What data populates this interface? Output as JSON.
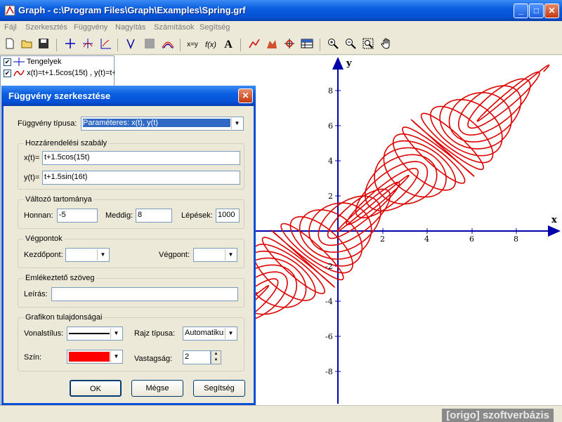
{
  "window": {
    "title": "Graph - c:\\Program Files\\Graph\\Examples\\Spring.grf",
    "min": "_",
    "max": "□",
    "close": "✕"
  },
  "menu": [
    "Fájl",
    "Szerkesztés",
    "Függvény",
    "Nagyítás",
    "Számítások",
    "Segítség"
  ],
  "toolbar": {
    "xy_label": "x=y",
    "fx_label": "f(x)",
    "text_label": "A"
  },
  "tree": {
    "items": [
      {
        "label": "Tengelyek",
        "checked": "✔"
      },
      {
        "label": "x(t)=t+1.5cos(15t) , y(t)=t+",
        "checked": "✔"
      }
    ]
  },
  "dialog": {
    "title": "Függvény szerkesztése",
    "close": "✕",
    "type_label": "Függvény típusa:",
    "type_value": "Paraméteres: x(t), y(t)",
    "rule_group": "Hozzárendelési szabály",
    "x_label": "x(t)=",
    "x_value": "t+1.5cos(15t)",
    "y_label": "y(t)=",
    "y_value": "t+1.5sin(16t)",
    "range_group": "Változó tartománya",
    "from_label": "Honnan:",
    "from_value": "-5",
    "to_label": "Meddig:",
    "to_value": "8",
    "steps_label": "Lépések:",
    "steps_value": "1000",
    "endpoints_group": "Végpontok",
    "start_label": "Kezdőpont:",
    "start_value": "",
    "end_label": "Végpont:",
    "end_value": "",
    "note_group": "Emlékeztető szöveg",
    "desc_label": "Leírás:",
    "desc_value": "",
    "props_group": "Grafikon tulajdonságai",
    "linestyle_label": "Vonalstílus:",
    "drawtype_label": "Rajz típusa:",
    "drawtype_value": "Automatikus",
    "color_label": "Szín:",
    "color_value": "#ff0000",
    "width_label": "Vastagság:",
    "width_value": "2",
    "ok": "OK",
    "cancel": "Mégse",
    "help": "Segítség"
  },
  "graph": {
    "x_axis_label": "x",
    "y_axis_label": "y",
    "x_ticks": [
      "2",
      "4",
      "6",
      "8"
    ],
    "y_ticks_pos": [
      "8",
      "6",
      "4",
      "2"
    ],
    "y_ticks_neg": [
      "-2",
      "-4",
      "-6",
      "-8"
    ],
    "curve_color": "#dd0000"
  },
  "status": {
    "watermark": "[origo] szoftverbázis"
  }
}
